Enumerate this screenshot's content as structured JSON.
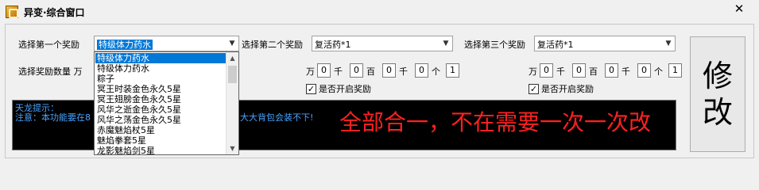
{
  "window": {
    "title": "异变·综合窗口",
    "close_glyph": "✕"
  },
  "group1": {
    "label": "选择第一个奖励",
    "selected": "特级体力药水",
    "count_label": "选择奖励数量  万"
  },
  "group2": {
    "label": "选择第二个奖励",
    "selected": "复活药*1",
    "enable_label": "是否开启奖励"
  },
  "group3": {
    "label": "选择第三个奖励",
    "selected": "复活药*1",
    "enable_label": "是否开启奖励"
  },
  "qty_units": {
    "wan": "万",
    "qian": "千",
    "bai": "百",
    "ge": "个"
  },
  "qty_group2": {
    "wan": "0",
    "qian": "0",
    "bai": "0",
    "qian2": "0",
    "ge": "1"
  },
  "qty_group3": {
    "wan": "0",
    "qian": "0",
    "bai": "0",
    "qian2": "0",
    "ge": "1"
  },
  "console": {
    "line1": "天龙提示：",
    "line2_left": "注意：本功能要在8",
    "line2_right": "大大背包会装不下!",
    "big_text": "全部合一，不在需要一次一次改"
  },
  "modify_button": {
    "char1": "修",
    "char2": "改"
  },
  "dropdown": {
    "items": [
      "特级体力药水",
      "特级体力药水",
      "粽子",
      "冥王时装金色永久5星",
      "冥王翅膀金色永久5星",
      "风华之逝金色永久5星",
      "风华之荡金色永久5星",
      "赤魔魅焰杖5星",
      "魅焰拳套5星",
      "龙影魅焰剑5星"
    ],
    "active_index": 0
  },
  "colors": {
    "selection": "#0078d7",
    "console_text": "#4aa3ff",
    "big_text": "#ff2020"
  }
}
